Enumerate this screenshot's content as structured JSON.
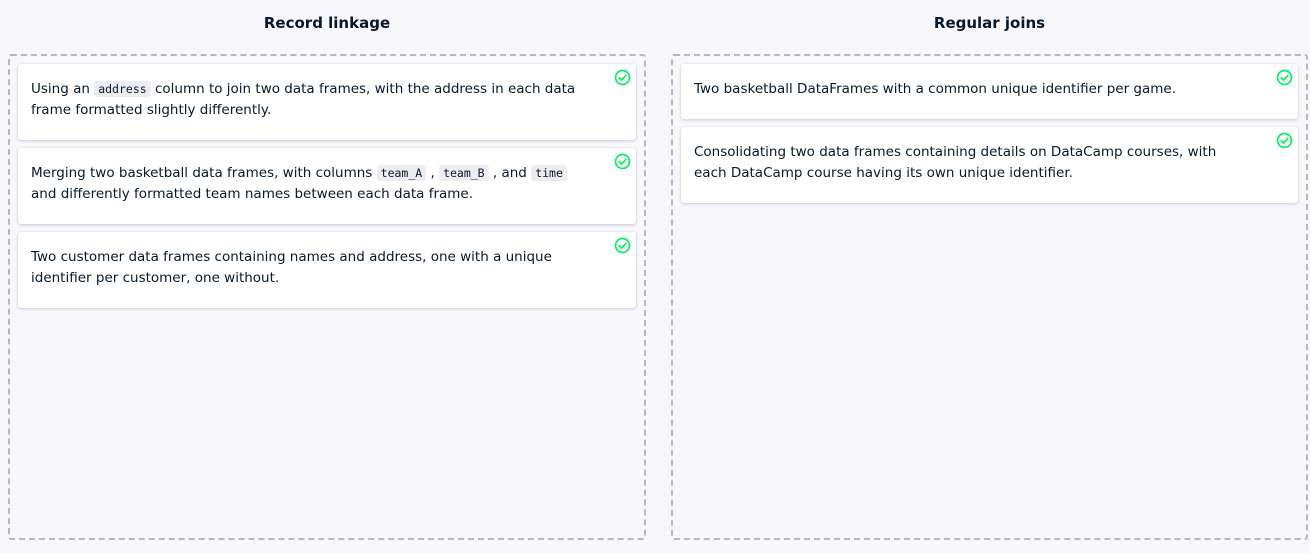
{
  "colors": {
    "background": "#f7f7fc",
    "text": "#05192d",
    "check": "#03ef62",
    "dashed_border": "#b7b7c1"
  },
  "columns": [
    {
      "title": "Record linkage",
      "cards": [
        {
          "parts": [
            "Using an ",
            "address",
            " column to join two data frames, with the address in each data frame formatted slightly differently."
          ],
          "status_icon": "check-circle-icon"
        },
        {
          "parts": [
            "Merging two basketball data frames, with columns ",
            "team_A",
            " , ",
            "team_B",
            " , and ",
            "time",
            " and differently formatted team names between each data frame."
          ],
          "status_icon": "check-circle-icon"
        },
        {
          "text": "Two customer data frames containing names and address, one with a unique identifier per customer, one without.",
          "status_icon": "check-circle-icon"
        }
      ]
    },
    {
      "title": "Regular joins",
      "cards": [
        {
          "text": "Two basketball DataFrames with a common unique identifier per game.",
          "status_icon": "check-circle-icon"
        },
        {
          "text": "Consolidating two data frames containing details on DataCamp courses, with each DataCamp course having its own unique identifier.",
          "status_icon": "check-circle-icon"
        }
      ]
    }
  ]
}
